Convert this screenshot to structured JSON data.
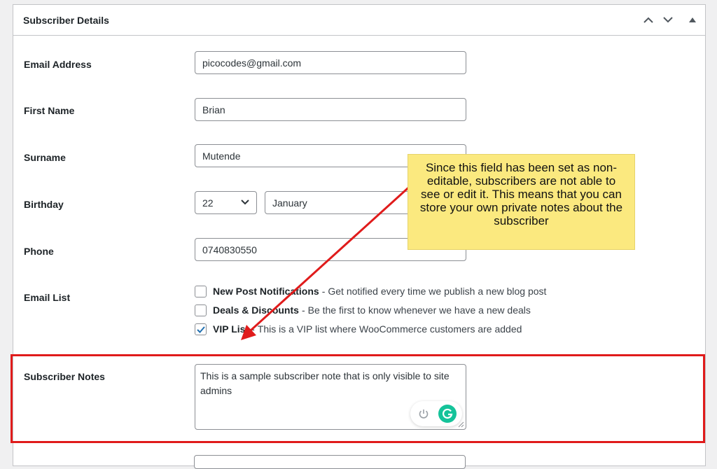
{
  "panel": {
    "title": "Subscriber Details"
  },
  "fields": {
    "email": {
      "label": "Email Address",
      "value": "picocodes@gmail.com"
    },
    "first_name": {
      "label": "First Name",
      "value": "Brian"
    },
    "surname": {
      "label": "Surname",
      "value": "Mutende"
    },
    "birthday": {
      "label": "Birthday",
      "day": "22",
      "month": "January"
    },
    "phone": {
      "label": "Phone",
      "value": "0740830550"
    }
  },
  "email_list": {
    "label": "Email List",
    "options": [
      {
        "name": "New Post Notifications",
        "description": "Get notified every time we publish a new blog post",
        "checked": false
      },
      {
        "name": "Deals & Discounts",
        "description": "Be the first to know whenever we have a new deals",
        "checked": false
      },
      {
        "name": "VIP List",
        "description": "This is a VIP list where WooCommerce customers are added",
        "checked": true
      }
    ]
  },
  "notes": {
    "label": "Subscriber Notes",
    "value": "This is a sample subscriber note that is only visible to site admins"
  },
  "callout": {
    "text": "Since this field has been set as non-editable, subscribers are not able to see or edit it. This means that you can store your own private notes about the subscriber"
  },
  "colors": {
    "highlight": "#e01b1b",
    "callout_bg": "#fbe97f",
    "checkbox_accent": "#2271b1",
    "grammarly": "#15c39a"
  },
  "icons": {
    "header": [
      "chevron-up-icon",
      "chevron-down-icon",
      "triangle-up-icon"
    ],
    "select": "chevron-down-icon",
    "checkbox": "checkmark-icon",
    "grammarly": [
      "power-icon",
      "grammarly-logo-icon"
    ]
  }
}
